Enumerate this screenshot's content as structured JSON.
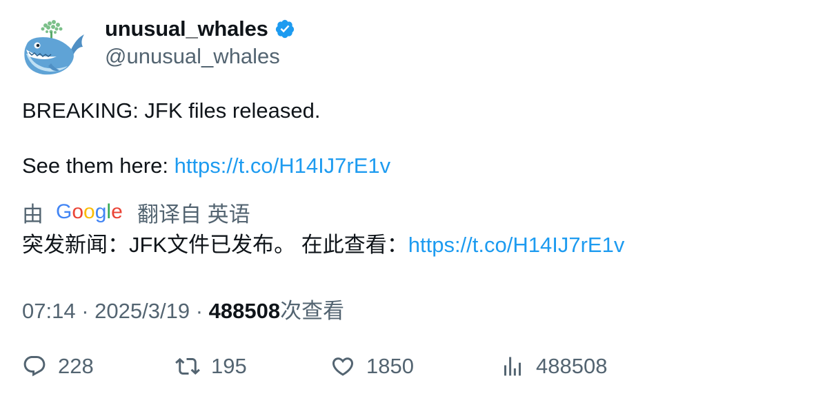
{
  "author": {
    "display_name": "unusual_whales",
    "handle": "@unusual_whales",
    "verified": true
  },
  "tweet": {
    "line1": "BREAKING: JFK files released.",
    "line2_prefix": "See them here: ",
    "link": "https://t.co/H14IJ7rE1v"
  },
  "translation": {
    "by": "由",
    "google": "Google",
    "from": "翻译自 英语",
    "text": "突发新闻：JFK文件已发布。 在此查看：",
    "link": "https://t.co/H14IJ7rE1v"
  },
  "meta": {
    "time": "07:14",
    "separator": "·",
    "date": "2025/3/19",
    "views_count": "488508",
    "views_suffix": "次查看"
  },
  "actions": {
    "replies": "228",
    "retweets": "195",
    "likes": "1850",
    "views": "488508"
  },
  "colors": {
    "link": "#1d9bf0",
    "secondary_text": "#536471",
    "primary_text": "#0f1419",
    "verified": "#1d9bf0"
  }
}
